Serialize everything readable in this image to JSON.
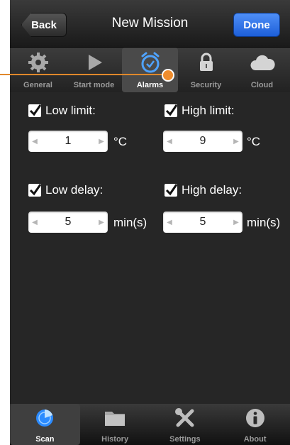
{
  "nav": {
    "back_label": "Back",
    "title": "New Mission",
    "done_label": "Done"
  },
  "tabs": [
    {
      "label": "General",
      "icon": "gear-icon",
      "active": false
    },
    {
      "label": "Start mode",
      "icon": "play-icon",
      "active": false
    },
    {
      "label": "Alarms",
      "icon": "alarm-clock-icon",
      "active": true
    },
    {
      "label": "Security",
      "icon": "lock-icon",
      "active": false
    },
    {
      "label": "Cloud",
      "icon": "cloud-icon",
      "active": false
    }
  ],
  "alarms": {
    "low_limit": {
      "label": "Low limit:",
      "checked": true,
      "value": "1",
      "unit": "°C"
    },
    "high_limit": {
      "label": "High limit:",
      "checked": true,
      "value": "9",
      "unit": "°C"
    },
    "low_delay": {
      "label": "Low delay:",
      "checked": true,
      "value": "5",
      "unit": "min(s)"
    },
    "high_delay": {
      "label": "High delay:",
      "checked": true,
      "value": "5",
      "unit": "min(s)"
    }
  },
  "tabbar": [
    {
      "label": "Scan",
      "icon": "radar-icon",
      "active": true
    },
    {
      "label": "History",
      "icon": "folder-icon",
      "active": false
    },
    {
      "label": "Settings",
      "icon": "tools-icon",
      "active": false
    },
    {
      "label": "About",
      "icon": "info-icon",
      "active": false
    }
  ],
  "colors": {
    "done_button": "#2f74e8",
    "active_icon": "#4fa3ff",
    "callout": "#ef8d2e"
  }
}
